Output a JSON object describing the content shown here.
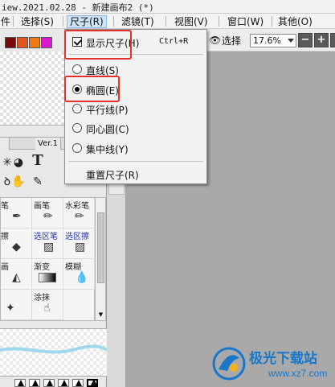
{
  "window": {
    "title": "iew.2021.02.28 - 新建画布2 (*)"
  },
  "menubar": {
    "items": [
      {
        "label": "文件",
        "partial": "件"
      },
      {
        "label": "选择(S)"
      },
      {
        "label": "尺子(R)"
      },
      {
        "label": "滤镜(T)"
      },
      {
        "label": "视图(V)"
      },
      {
        "label": "窗口(W)"
      },
      {
        "label": "其他(O)"
      }
    ]
  },
  "toolbar": {
    "select_label": "选择",
    "zoom": "17.6%",
    "minus": "−",
    "plus": "+",
    "reset": "0"
  },
  "colors": {
    "swatches": [
      "#7a0a0a",
      "#e0561f",
      "#ef7a10",
      "#d91ad1"
    ],
    "highlight": "#e4322b",
    "brand": "#1877c8"
  },
  "left_panel": {
    "tabs": [
      "Ver.1",
      "画具"
    ],
    "tools": [
      {
        "label": "画笔"
      },
      {
        "label": "水彩笔"
      },
      {
        "label": "选区笔"
      },
      {
        "label": "选区擦"
      },
      {
        "label": "渐变"
      },
      {
        "label": "模糊"
      },
      {
        "label": "涂抹"
      }
    ],
    "cut_labels": [
      "笔",
      "擦",
      "笔",
      "画",
      "涂抹"
    ]
  },
  "ruler_menu": {
    "items": [
      {
        "label": "显示尺子(H)",
        "shortcut": "Ctrl+R",
        "kind": "check",
        "checked": true
      },
      {
        "label": "直线(S)",
        "kind": "radio",
        "checked": false
      },
      {
        "label": "椭圆(E)",
        "kind": "radio",
        "checked": true
      },
      {
        "label": "平行线(P)",
        "kind": "radio",
        "checked": false
      },
      {
        "label": "同心圆(C)",
        "kind": "radio",
        "checked": false
      },
      {
        "label": "集中线(Y)",
        "kind": "radio",
        "checked": false
      },
      {
        "label": "重置尺子(R)",
        "kind": "plain"
      }
    ]
  },
  "watermark": {
    "brand": "极光下载站",
    "url": "www.xz7.com"
  }
}
